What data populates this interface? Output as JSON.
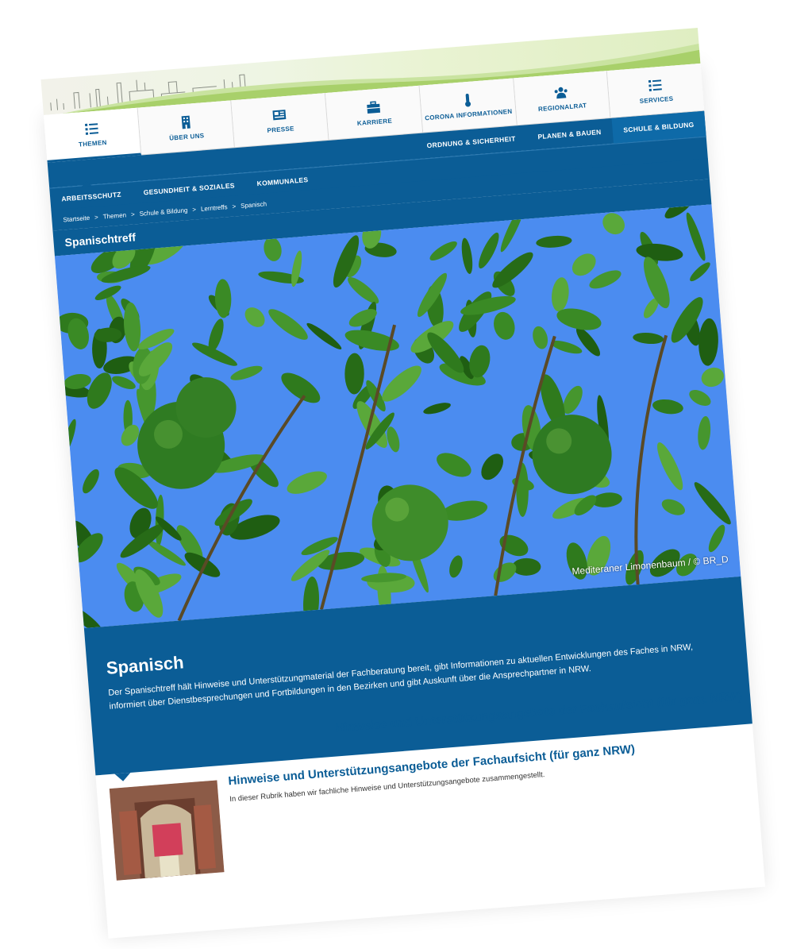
{
  "top_nav": [
    {
      "label": "THEMEN",
      "icon": "list-icon"
    },
    {
      "label": "ÜBER UNS",
      "icon": "building-icon"
    },
    {
      "label": "PRESSE",
      "icon": "newspaper-icon"
    },
    {
      "label": "KARRIERE",
      "icon": "briefcase-icon"
    },
    {
      "label": "CORONA INFORMATIONEN",
      "icon": "thermometer-icon"
    },
    {
      "label": "REGIONALRAT",
      "icon": "users-icon"
    },
    {
      "label": "SERVICES",
      "icon": "list-icon"
    }
  ],
  "subnav_row1": [
    "ORDNUNG & SICHERHEIT",
    "PLANEN & BAUEN",
    "SCHULE & BILDUNG"
  ],
  "subnav_row2": [
    "ARBEITSSCHUTZ",
    "GESUNDHEIT & SOZIALES",
    "KOMMUNALES"
  ],
  "breadcrumb": [
    "Startseite",
    ">",
    "Themen",
    ">",
    "Schule & Bildung",
    ">",
    "Lerntreffs",
    ">",
    "Spanisch"
  ],
  "page_title": "Spanischtreff",
  "photo_caption": "Mediteraner Limonenbaum  / © BR_D",
  "intro": {
    "heading": "Spanisch",
    "text": "Der Spanischtreff hält Hinweise und Unterstützungmaterial der Fachberatung bereit, gibt Informationen zu aktuellen Entwicklungen des Faches in NRW, informiert über Dienstbesprechungen und Fortbildungen in den Bezirken und gibt Auskunft über die Ansprechpartner in NRW."
  },
  "section_heading": "Hinweise und Unterstützungsangebote der Fachaufsicht (für ganz NRW)",
  "teaser": {
    "title": "Hinweise und Unterstützungsangebote der Fachaufsicht (für ganz NRW)",
    "text": "In dieser Rubrik haben wir fachliche Hinweise und Unterstützungsangebote zusammengestellt."
  },
  "colors": {
    "primary": "#0b5d96",
    "sky": "#4b8cf0",
    "leaf": "#2f7a1d"
  }
}
